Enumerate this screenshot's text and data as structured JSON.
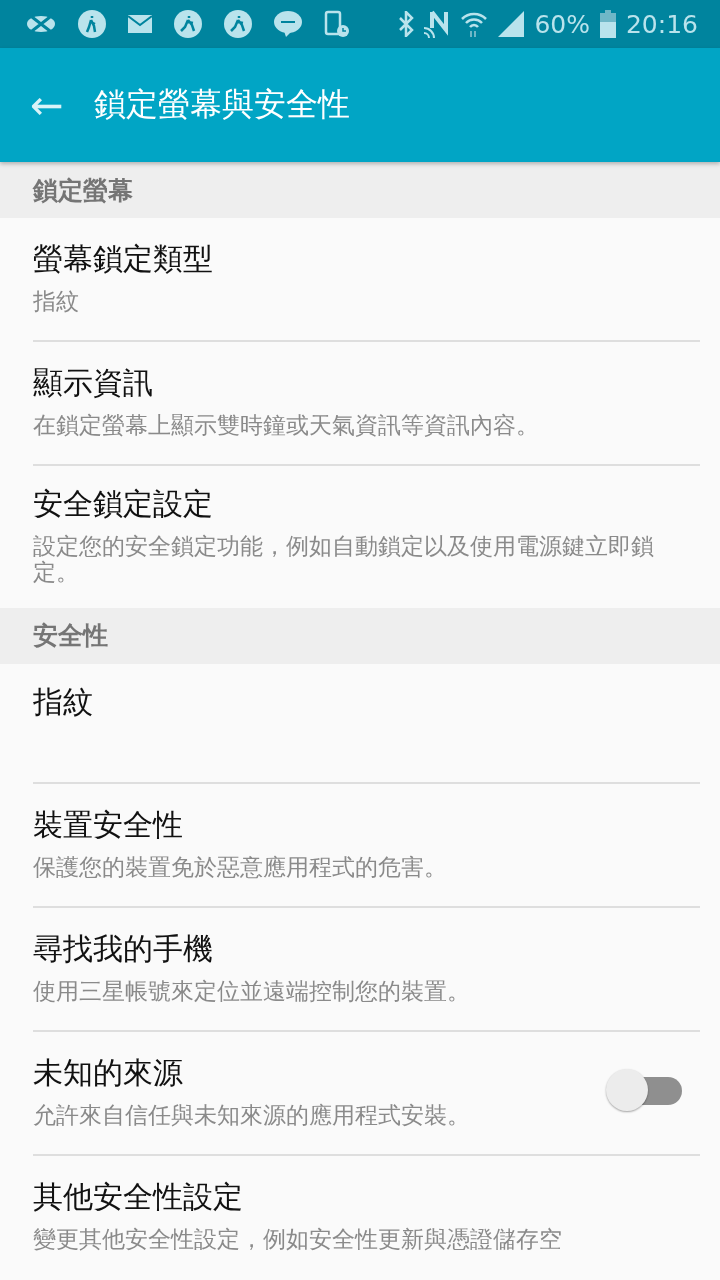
{
  "status_bar": {
    "battery": "60%",
    "time": "20:16"
  },
  "app_bar": {
    "back": "←",
    "title": "鎖定螢幕與安全性"
  },
  "sections": [
    {
      "header": "鎖定螢幕",
      "items": [
        {
          "kind": "text",
          "title": "螢幕鎖定類型",
          "summary": "指紋"
        },
        {
          "kind": "text",
          "title": "顯示資訊",
          "summary": "在鎖定螢幕上顯示雙時鐘或天氣資訊等資訊內容。"
        },
        {
          "kind": "text",
          "title": "安全鎖定設定",
          "summary": "設定您的安全鎖定功能，例如自動鎖定以及使用電源鍵立即鎖定。"
        }
      ]
    },
    {
      "header": "安全性",
      "items": [
        {
          "kind": "text",
          "title": "指紋"
        },
        {
          "kind": "text",
          "title": "裝置安全性",
          "summary": "保護您的裝置免於惡意應用程式的危害。"
        },
        {
          "kind": "text",
          "title": "尋找我的手機",
          "summary": "使用三星帳號來定位並遠端控制您的裝置。"
        },
        {
          "kind": "switch",
          "title": "未知的來源",
          "summary": "允許來自信任與未知來源的應用程式安裝。",
          "on": false
        },
        {
          "kind": "text",
          "title": "其他安全性設定",
          "summary": "變更其他安全性設定，例如安全性更新與憑證儲存空"
        }
      ]
    }
  ]
}
